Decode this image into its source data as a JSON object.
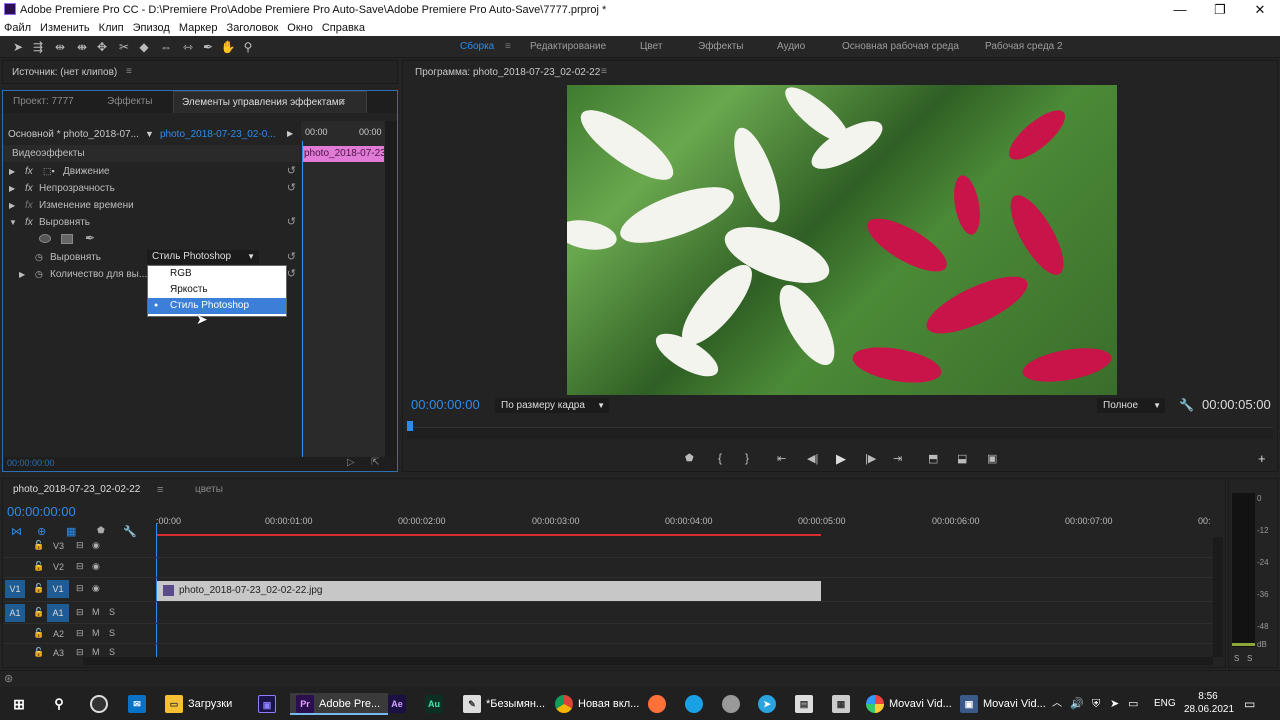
{
  "window": {
    "title": "Adobe Premiere Pro CC - D:\\Premiere Pro\\Adobe Premiere Pro Auto-Save\\Adobe Premiere Pro Auto-Save\\7777.prproj *"
  },
  "menu": [
    "Файл",
    "Изменить",
    "Клип",
    "Эпизод",
    "Маркер",
    "Заголовок",
    "Окно",
    "Справка"
  ],
  "workspaces": [
    {
      "label": "Сборка",
      "active": true
    },
    {
      "label": "Редактирование"
    },
    {
      "label": "Цвет"
    },
    {
      "label": "Эффекты"
    },
    {
      "label": "Аудио"
    },
    {
      "label": "Основная рабочая среда"
    },
    {
      "label": "Рабочая среда 2"
    }
  ],
  "source_panel": {
    "title": "Источник: (нет клипов)"
  },
  "left_tabs": {
    "project": "Проект: 7777",
    "effects": "Эффекты",
    "effect_controls": "Элементы управления эффектами"
  },
  "effect_controls": {
    "master": "Основной * photo_2018-07...",
    "clip": "photo_2018-07-23_02-0...",
    "time_a": "00:00",
    "time_b": "00:00",
    "clip_bar": "photo_2018-07-23",
    "section": "Видеоэффекты",
    "effects": [
      "Движение",
      "Непрозрачность",
      "Изменение времени",
      "Выровнять"
    ],
    "param_label": "Выровнять",
    "param_value": "Стиль Photoshop",
    "param2_label": "Количество для вы...",
    "timecode": "00:00:00:00"
  },
  "dropdown": {
    "items": [
      "RGB",
      "Яркость",
      "Стиль Photoshop"
    ],
    "selected": "Стиль Photoshop"
  },
  "program": {
    "title": "Программа: photo_2018-07-23_02-02-22",
    "timecode": "00:00:00:00",
    "fit": "По размеру кадра",
    "quality": "Полное",
    "duration": "00:00:05:00"
  },
  "timeline": {
    "tab": "photo_2018-07-23_02-02-22",
    "tab2": "цветы",
    "timecode": "00:00:00:00",
    "ruler": [
      ":00:00",
      "00:00:01:00",
      "00:00:02:00",
      "00:00:03:00",
      "00:00:04:00",
      "00:00:05:00",
      "00:00:06:00",
      "00:00:07:00",
      "00:"
    ],
    "tracks": [
      "V3",
      "V2",
      "V1",
      "A1",
      "A2",
      "A3"
    ],
    "clip": "photo_2018-07-23_02-02-22.jpg",
    "meter_scale": [
      "0",
      "-12",
      "-24",
      "-36",
      "-48",
      "dB"
    ],
    "meter_solo": [
      "S",
      "S"
    ]
  },
  "taskbar": {
    "apps": [
      "Загрузки",
      "Adobe Pre...",
      "*Безымян...",
      "Новая вкл...",
      "Movavi Vid...",
      "Movavi Vid..."
    ],
    "lang": "ENG",
    "time": "8:56",
    "date": "28.06.2021"
  }
}
